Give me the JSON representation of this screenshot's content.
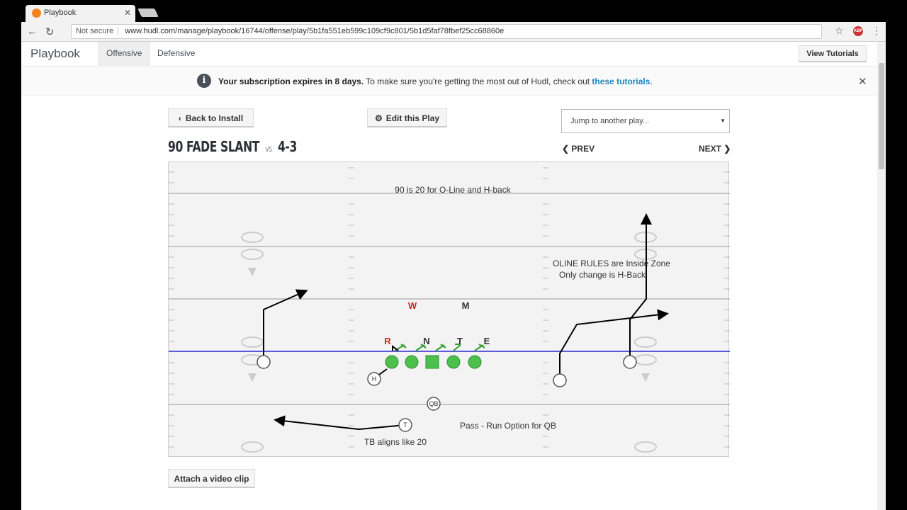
{
  "browser": {
    "tab_title": "Playbook",
    "security_label": "Not secure",
    "url": "www.hudl.com/manage/playbook/16744/offense/play/5b1fa551eb599c109cf9c801/5b1d5faf78fbef25cc68860e",
    "abp_label": "ABP"
  },
  "nav": {
    "brand": "Playbook",
    "tabs": [
      {
        "label": "Offensive"
      },
      {
        "label": "Defensive"
      }
    ],
    "tutorials_button": "View Tutorials"
  },
  "banner": {
    "bold": "Your subscription expires in 8 days.",
    "text": " To make sure you're getting the most out of Hudl, check out ",
    "link": "these tutorials",
    "end": "."
  },
  "toolbar": {
    "back_label": "Back to Install",
    "edit_label": "Edit this Play",
    "jump_placeholder": "Jump to another play..."
  },
  "play": {
    "name": "90 FADE SLANT",
    "vs_label": "vs",
    "defense": "4-3",
    "prev_label": "PREV",
    "next_label": "NEXT"
  },
  "diagram": {
    "notes": [
      "90 is 20 for O-Line and H-back",
      "OLINE RULES are Inside Zone",
      "Only change is H-Back",
      "Pass - Run Option for QB",
      "TB aligns like 20"
    ],
    "defenders": [
      "W",
      "M",
      "R",
      "N",
      "T",
      "E"
    ],
    "player_labels": [
      "H",
      "QB",
      "T"
    ],
    "colors": {
      "line_of_scrimmage": "#5b5bd6",
      "offensive_line": "#4cbf4c",
      "block_marks": "#2e9e2e",
      "defender_red": "#cc2222",
      "routes": "#000000"
    }
  },
  "footer": {
    "attach_label": "Attach a video clip"
  }
}
